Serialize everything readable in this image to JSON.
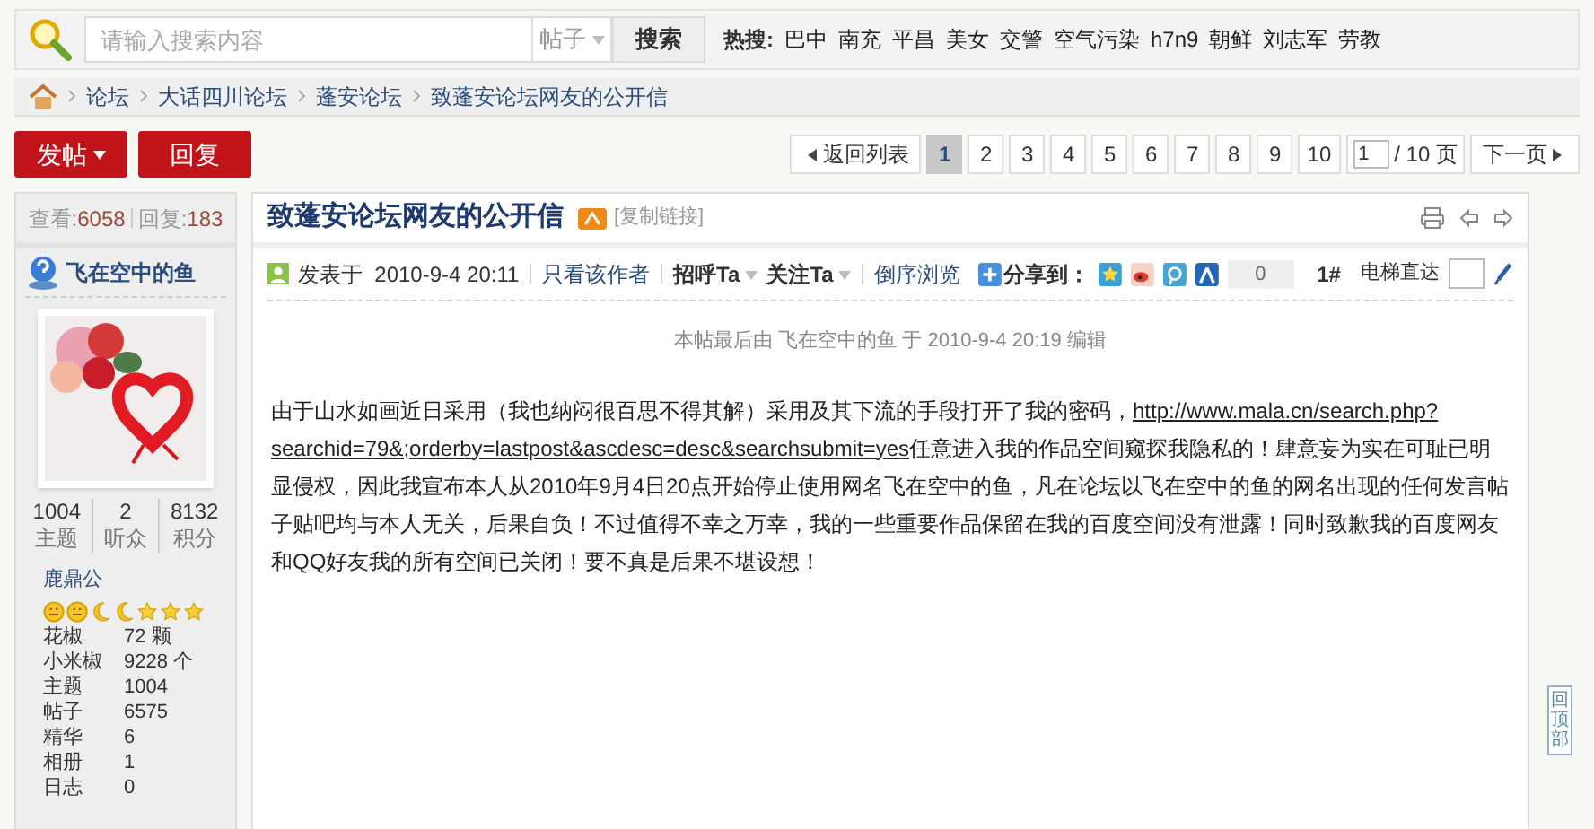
{
  "search": {
    "placeholder": "请输入搜索内容",
    "scope": "帖子",
    "button": "搜索",
    "hot_label": "热搜:",
    "hot_terms": [
      "巴中",
      "南充",
      "平昌",
      "美女",
      "交警",
      "空气污染",
      "h7n9",
      "朝鲜",
      "刘志军",
      "劳教"
    ]
  },
  "breadcrumb": [
    "论坛",
    "大话四川论坛",
    "蓬安论坛",
    "致蓬安论坛网友的公开信"
  ],
  "actions": {
    "post": "发帖",
    "reply": "回复"
  },
  "pagination": {
    "back": "返回列表",
    "pages": [
      {
        "label": "1",
        "selected": true
      },
      {
        "label": "2",
        "selected": false
      },
      {
        "label": "3",
        "selected": false
      },
      {
        "label": "4",
        "selected": false
      },
      {
        "label": "5",
        "selected": false
      },
      {
        "label": "6",
        "selected": false
      },
      {
        "label": "7",
        "selected": false
      },
      {
        "label": "8",
        "selected": false
      },
      {
        "label": "9",
        "selected": false
      },
      {
        "label": "10",
        "selected": false
      }
    ],
    "page_input": "1",
    "total": "/ 10 页",
    "next": "下一页"
  },
  "thread_stats": {
    "views_label": "查看:",
    "views": "6058",
    "replies_label": "回复:",
    "replies": "183"
  },
  "thread": {
    "title": "致蓬安论坛网友的公开信",
    "copy_link": "[复制链接]"
  },
  "author": {
    "name": "飞在空中的鱼",
    "stats": [
      {
        "value": "1004",
        "label": "主题"
      },
      {
        "value": "2",
        "label": "听众"
      },
      {
        "value": "8132",
        "label": "积分"
      }
    ],
    "rank": "鹿鼎公",
    "rank_icons": [
      {
        "kind": "sun"
      },
      {
        "kind": "sun"
      },
      {
        "kind": "moon"
      },
      {
        "kind": "moon"
      },
      {
        "kind": "star"
      },
      {
        "kind": "star"
      },
      {
        "kind": "star"
      }
    ],
    "fields": [
      {
        "label": "花椒",
        "value": "72 颗"
      },
      {
        "label": "小米椒",
        "value": "9228 个"
      },
      {
        "label": "主题",
        "value": "1004"
      },
      {
        "label": "帖子",
        "value": "6575"
      },
      {
        "label": "精华",
        "value": "6"
      },
      {
        "label": "相册",
        "value": "1"
      },
      {
        "label": "日志",
        "value": "0"
      }
    ]
  },
  "post": {
    "posted": "发表于  2010-9-4 20:11",
    "only_author": "只看该作者",
    "greet": "招呼Ta",
    "follow": "关注Ta",
    "reverse": "倒序浏览",
    "share": "分享到：",
    "share_count": "0",
    "floor": "1#",
    "elevator": "电梯直达",
    "edit_note": "本帖最后由 飞在空中的鱼 于 2010-9-4 20:19 编辑",
    "body_before": "由于山水如画近日采用（我也纳闷很百思不得其解）采用及其下流的手段打开了我的密码，",
    "link_part_1": "http://www.mala.cn/search.php?",
    "link_part_2": "searchid=79&;orderby=lastpost&ascdesc=desc&searchsubmit=yes",
    "body_after": "任意进入我的作品空间窥探我隐私的！肆意妄为实在可耻已明显侵权，因此我宣布本人从2010年9月4日20点开始停止使用网名飞在空中的鱼，凡在论坛以飞在空中的鱼的网名出现的任何发言帖子贴吧均与本人无关，后果自负！不过值得不幸之万幸，我的一些重要作品保留在我的百度空间没有泄露！同时致歉我的百度网友和QQ好友我的所有空间已关闭！要不真是后果不堪设想！"
  },
  "back_to_top": "回顶部"
}
